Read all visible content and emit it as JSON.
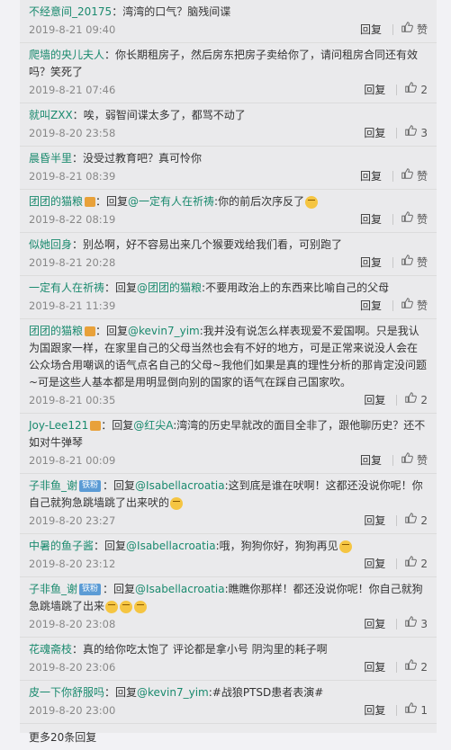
{
  "actions": {
    "reply_label": "回复",
    "like_label": "赞"
  },
  "comments": [
    {
      "user": "不经意间_20175",
      "badge": "",
      "mention": "",
      "colon": "：",
      "text": "湾湾的口气？脑残间谍",
      "emoji": "",
      "time": "2019-8-21 09:40",
      "likes": "赞"
    },
    {
      "user": "爬墙的央儿夫人",
      "badge": "",
      "mention": "",
      "colon": "：",
      "text": "你长期租房子，然后房东把房子卖给你了，请问租房合同还有效吗？笑死了",
      "emoji": "",
      "time": "2019-8-21 07:46",
      "likes": "2"
    },
    {
      "user": "就叫ZXX",
      "badge": "",
      "mention": "",
      "colon": "：",
      "text": "唉，弱智间谍太多了，都骂不动了",
      "emoji": "",
      "time": "2019-8-20 23:58",
      "likes": "3"
    },
    {
      "user": "晨昏半里",
      "badge": "",
      "mention": "",
      "colon": "：",
      "text": "没受过教育吧？真可怜你",
      "emoji": "",
      "time": "2019-8-21 08:39",
      "likes": "赞"
    },
    {
      "user": "团团的猫粮",
      "badge": "member",
      "mention": "@一定有人在祈祷",
      "colon": "：回复",
      "text": ":你的前后次序反了",
      "emoji": "smile",
      "time": "2019-8-22 08:19",
      "likes": "赞"
    },
    {
      "user": "似她回身",
      "badge": "",
      "mention": "",
      "colon": "：",
      "text": "别怂啊，好不容易出来几个猴要戏给我们看，可别跑了",
      "emoji": "",
      "time": "2019-8-21 20:28",
      "likes": "赞"
    },
    {
      "user": "一定有人在祈祷",
      "badge": "",
      "mention": "@团团的猫粮",
      "colon": "：回复",
      "text": ":不要用政治上的东西来比喻自己的父母",
      "emoji": "",
      "time": "2019-8-21 11:39",
      "likes": "赞"
    },
    {
      "user": "团团的猫粮",
      "badge": "member",
      "mention": "@kevin7_yim",
      "colon": "：回复",
      "text": ":我并没有说怎么样表现爱不爱国啊。只是我认为国跟家一样，在家里自己的父母当然也会有不好的地方，可是正常来说没人会在公众场合用嘲讽的语气点名自己的父母~我他们如果是真的理性分析的那肯定没问题~可是这些人基本都是用明显倒向别的国家的语气在踩自己国家吹。",
      "emoji": "",
      "time": "2019-8-21 00:35",
      "likes": "2"
    },
    {
      "user": "Joy-Lee121",
      "badge": "member",
      "mention": "@红尖A",
      "colon": "：回复",
      "text": ":湾湾的历史早就改的面目全非了，跟他聊历史？还不如对牛弹琴",
      "emoji": "",
      "time": "2019-8-21 00:09",
      "likes": "赞"
    },
    {
      "user": "子非鱼_谢",
      "badge": "铁粉",
      "mention": "@Isabellacroatia",
      "colon": "：回复",
      "text": ":这到底是谁在吠啊！这都还没说你呢！你自己就狗急跳墙跳了出来吠的",
      "emoji": "smile",
      "time": "2019-8-20 23:27",
      "likes": "2"
    },
    {
      "user": "中暑的鱼子酱",
      "badge": "",
      "mention": "@Isabellacroatia",
      "colon": "：回复",
      "text": ":哦，狗狗你好，狗狗再见",
      "emoji": "smile",
      "time": "2019-8-20 23:12",
      "likes": "2"
    },
    {
      "user": "子非鱼_谢",
      "badge": "铁粉",
      "mention": "@Isabellacroatia",
      "colon": "：回复",
      "text": ":瞧瞧你那样！都还没说你呢！你自己就狗急跳墙跳了出来",
      "emoji": "smile3",
      "time": "2019-8-20 23:08",
      "likes": "3"
    },
    {
      "user": "花魂斋枝",
      "badge": "",
      "mention": "",
      "colon": "：",
      "text": "真的给你吃太饱了 评论都是拿小号 阴沟里的耗子啊",
      "emoji": "",
      "time": "2019-8-20 23:06",
      "likes": "2"
    },
    {
      "user": "皮一下你舒服吗",
      "badge": "",
      "mention": "@kevin7_yim",
      "colon": "：回复",
      "text": ":#战狼PTSD患者表演#",
      "emoji": "",
      "time": "2019-8-20 23:00",
      "likes": "1"
    }
  ],
  "more_label": "更多20条回复"
}
